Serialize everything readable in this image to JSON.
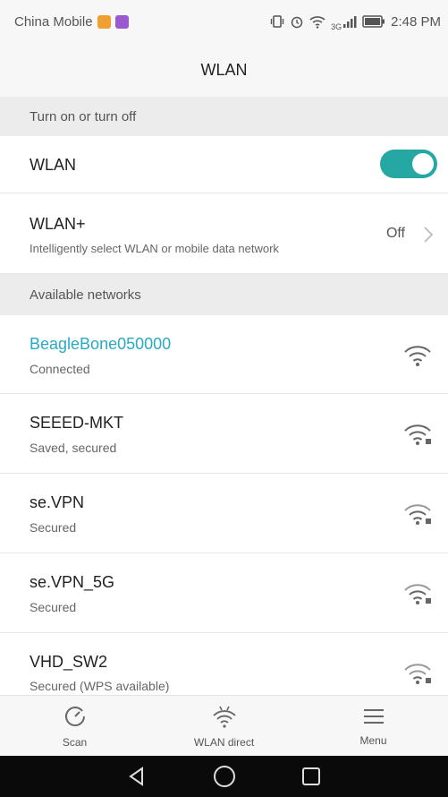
{
  "status_bar": {
    "carrier": "China Mobile",
    "network_type": "3G",
    "time": "2:48 PM",
    "icons": [
      "app-badge-orange-icon",
      "app-badge-purple-icon",
      "vibrate-icon",
      "alarm-icon",
      "wifi-icon",
      "signal-icon",
      "battery-icon"
    ]
  },
  "header": {
    "title": "WLAN"
  },
  "sections": {
    "toggle_section": "Turn on or turn off",
    "available": "Available networks"
  },
  "wlan_toggle": {
    "label": "WLAN",
    "on": true
  },
  "wlan_plus": {
    "label": "WLAN+",
    "description": "Intelligently select WLAN or mobile data network",
    "value": "Off"
  },
  "networks": [
    {
      "name": "BeagleBone050000",
      "status": "Connected",
      "connected": true
    },
    {
      "name": "SEEED-MKT",
      "status": "Saved, secured"
    },
    {
      "name": "se.VPN",
      "status": "Secured"
    },
    {
      "name": "se.VPN_5G",
      "status": "Secured"
    },
    {
      "name": "VHD_SW2",
      "status": "Secured (WPS available)"
    }
  ],
  "bottom_actions": {
    "scan": "Scan",
    "wlan_direct": "WLAN direct",
    "menu": "Menu"
  },
  "colors": {
    "accent": "#25a7a4",
    "connected_text": "#2aa9c4"
  }
}
